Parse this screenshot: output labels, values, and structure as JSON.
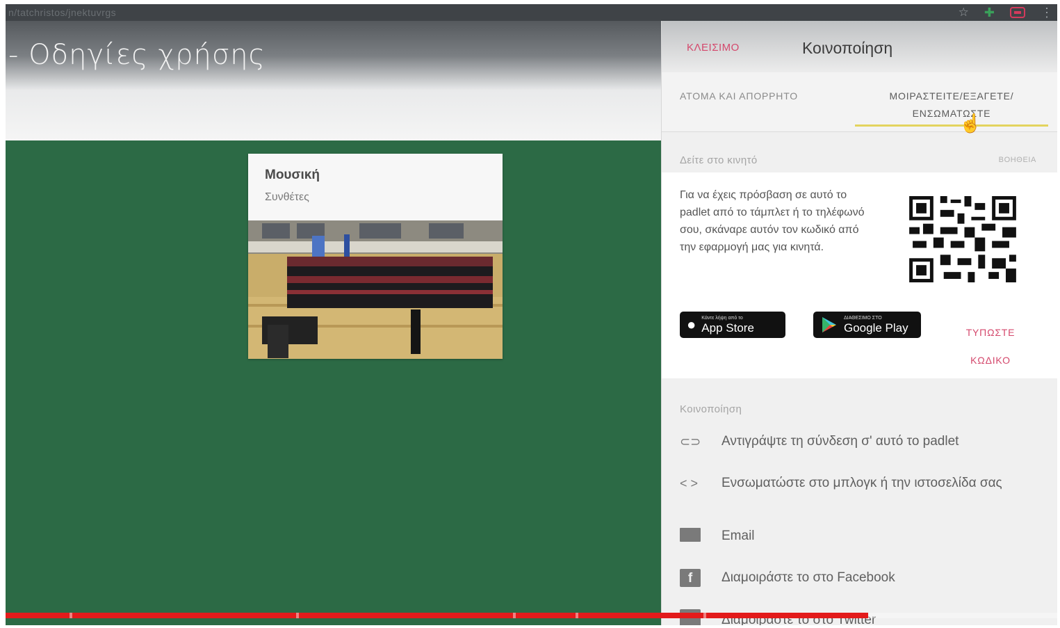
{
  "browser": {
    "url": "n/tatchristos/jnektuvrgs",
    "icons": [
      "star-icon",
      "extension-puzzle-icon",
      "cast-extension-icon",
      "menu-kebab-icon"
    ]
  },
  "padlet": {
    "title": "- Οδηγίες χρήσης",
    "background_color": "#2c6a45"
  },
  "post": {
    "title": "Μουσική",
    "subtitle": "Συνθέτες"
  },
  "share_panel": {
    "close_label": "ΚΛΕΙΣΙΜΟ",
    "title": "Κοινοποίηση",
    "tabs": [
      {
        "label": "ΑΤΟΜΑ ΚΑΙ ΑΠΟΡΡΗΤΟ",
        "active": false
      },
      {
        "label": "ΜΟΙΡΑΣΤΕΙΤΕ/ΕΞΑΓΕΤΕ/ ΕΝΣΩΜΑΤΩΣΤΕ",
        "active": true
      }
    ],
    "mobile": {
      "label": "Δείτε στο κινητό",
      "help_label": "ΒΟΗΘΕΙΑ",
      "description": "Για να έχεις πρόσβαση σε αυτό το padlet από το τάμπλετ ή το τηλέφωνό σου, σκάναρε αυτόν τον κωδικό από την εφαρμογή μας για κινητά.",
      "app_store_small": "Κάντε λήψη από το",
      "app_store_big": "App Store",
      "google_play_small": "ΔΙΑΘΕΣΙΜΟ ΣΤΟ",
      "google_play_big": "Google Play",
      "enter_code": "ΤΥΠΩΣΤΕ ΚΩΔΙΚΟ"
    },
    "share": {
      "label": "Κοινοποίηση",
      "options": [
        {
          "icon": "link-icon",
          "label": "Αντιγράψτε τη σύνδεση σ' αυτό το padlet"
        },
        {
          "icon": "code-icon",
          "label": "Ενσωματώστε στο μπλογκ ή την ιστοσελίδα σας"
        },
        {
          "icon": "email-icon",
          "label": "Email"
        },
        {
          "icon": "facebook-icon",
          "label": "Διαμοιράστε το στο Facebook"
        },
        {
          "icon": "twitter-icon",
          "label": "Διαμοιράστε το στο Twitter"
        }
      ]
    },
    "accent_color": "#d4486c",
    "tab_underline_color": "#e3d35e"
  },
  "video_progress": {
    "played_fraction": 0.82,
    "color": "#e31b1b"
  }
}
